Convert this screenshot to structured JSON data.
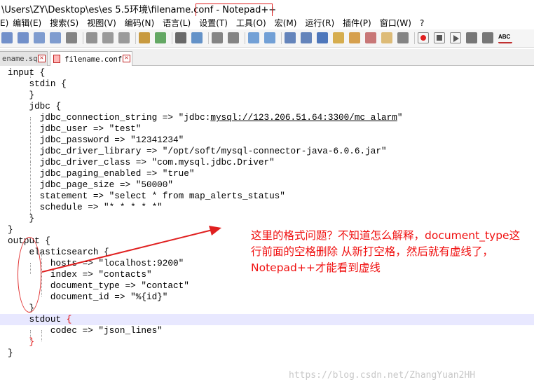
{
  "window": {
    "title": "\\Users\\ZY\\Desktop\\es\\es 5.5环境\\filename.conf - Notepad++"
  },
  "menu": [
    "编辑(E)",
    "搜索(S)",
    "视图(V)",
    "编码(N)",
    "语言(L)",
    "设置(T)",
    "工具(O)",
    "宏(M)",
    "运行(R)",
    "插件(P)",
    "窗口(W)",
    "?"
  ],
  "menu_partial_left": "E)",
  "toolbar": {
    "icons": [
      "save-icon",
      "save-all-icon",
      "close-icon",
      "close-all-icon",
      "print-icon",
      "cut-icon",
      "copy-icon",
      "paste-icon",
      "undo-icon",
      "redo-icon",
      "find-icon",
      "replace-icon",
      "zoom-in-icon",
      "zoom-out-icon",
      "sync-v-icon",
      "sync-h-icon",
      "wrap-icon",
      "all-chars-icon",
      "indent-guide-icon",
      "udl-icon",
      "doc-map-icon",
      "function-list-icon",
      "folder-icon",
      "monitor-icon",
      "record-icon",
      "stop-icon",
      "play-icon",
      "play-multi-icon",
      "save-macro-icon",
      "spellcheck-icon"
    ],
    "spellcheck_label": "ABC"
  },
  "tabs": [
    {
      "label": "ename.sql",
      "active": false
    },
    {
      "label": "filename.conf",
      "active": true
    }
  ],
  "code_lines": [
    {
      "text": "input {"
    },
    {
      "text": "    stdin {"
    },
    {
      "text": "    }"
    },
    {
      "text": "    jdbc {"
    },
    {
      "pre": "      jdbc_connection_string => \"jdbc:",
      "under": "mysql://123.206.51.64:3300/mc_alarm",
      "post": "\""
    },
    {
      "text": "      jdbc_user => \"test\""
    },
    {
      "text": "      jdbc_password => \"12341234\""
    },
    {
      "text": "      jdbc_driver_library => \"/opt/soft/mysql-connector-java-6.0.6.jar\""
    },
    {
      "text": "      jdbc_driver_class => \"com.mysql.jdbc.Driver\""
    },
    {
      "text": "      jdbc_paging_enabled => \"true\""
    },
    {
      "text": "      jdbc_page_size => \"50000\""
    },
    {
      "text": "      statement => \"select * from map_alerts_status\""
    },
    {
      "text": "      schedule => \"* * * * *\""
    },
    {
      "text": "    }"
    },
    {
      "text": "}"
    },
    {
      "text": "output {"
    },
    {
      "text": "    elasticsearch {"
    },
    {
      "text": "        hosts => \"localhost:9200\""
    },
    {
      "text": "        index => \"contacts\""
    },
    {
      "text": "        document_type => \"contact\""
    },
    {
      "text": "        document_id => \"%{id}\""
    },
    {
      "text": "    }"
    },
    {
      "pre": "    stdout ",
      "brace": "{",
      "post": ""
    },
    {
      "text": "        codec => \"json_lines\""
    },
    {
      "pre": "    ",
      "brace": "}",
      "post": ""
    },
    {
      "text": "}"
    }
  ],
  "annotation": {
    "text": "这里的格式问题？不知道怎么解释，document_type这行前面的空格删除 从新打空格，然后就有虚线了，Notepad++才能看到虚线"
  },
  "watermark": "https://blog.csdn.net/ZhangYuan2HH",
  "colors": {
    "annotation": "#f01010",
    "current_line": "#e8e8ff",
    "brace_highlight": "#e00000"
  }
}
